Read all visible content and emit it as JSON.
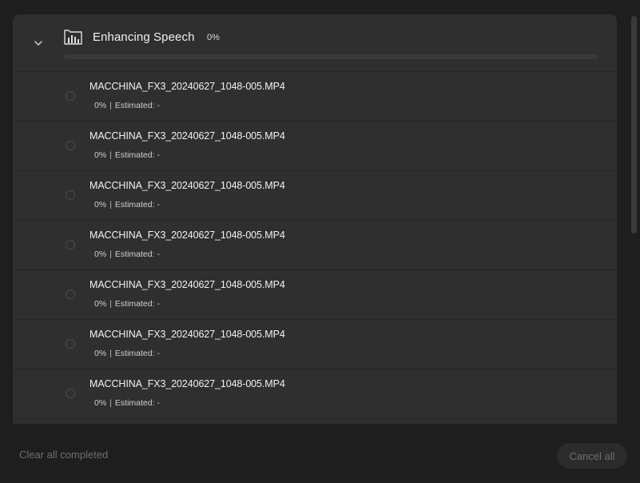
{
  "header": {
    "title": "Enhancing Speech",
    "percent": "0%",
    "progress_fraction": 0,
    "icon": "speech-enhance-icon",
    "toggle_icon": "chevron-down-icon"
  },
  "items": [
    {
      "filename": "MACCHINA_FX3_20240627_1048-005.MP4",
      "percent": "0%",
      "separator": "|",
      "estimated": "Estimated: -"
    },
    {
      "filename": "MACCHINA_FX3_20240627_1048-005.MP4",
      "percent": "0%",
      "separator": "|",
      "estimated": "Estimated: -"
    },
    {
      "filename": "MACCHINA_FX3_20240627_1048-005.MP4",
      "percent": "0%",
      "separator": "|",
      "estimated": "Estimated: -"
    },
    {
      "filename": "MACCHINA_FX3_20240627_1048-005.MP4",
      "percent": "0%",
      "separator": "|",
      "estimated": "Estimated: -"
    },
    {
      "filename": "MACCHINA_FX3_20240627_1048-005.MP4",
      "percent": "0%",
      "separator": "|",
      "estimated": "Estimated: -"
    },
    {
      "filename": "MACCHINA_FX3_20240627_1048-005.MP4",
      "percent": "0%",
      "separator": "|",
      "estimated": "Estimated: -"
    },
    {
      "filename": "MACCHINA_FX3_20240627_1048-005.MP4",
      "percent": "0%",
      "separator": "|",
      "estimated": "Estimated: -"
    }
  ],
  "footer": {
    "clear_label": "Clear all completed",
    "cancel_label": "Cancel all"
  },
  "colors": {
    "background": "#1e1e1e",
    "panel": "#2f2f2f",
    "text": "#f2f2f2",
    "muted": "#6f6f6f"
  }
}
